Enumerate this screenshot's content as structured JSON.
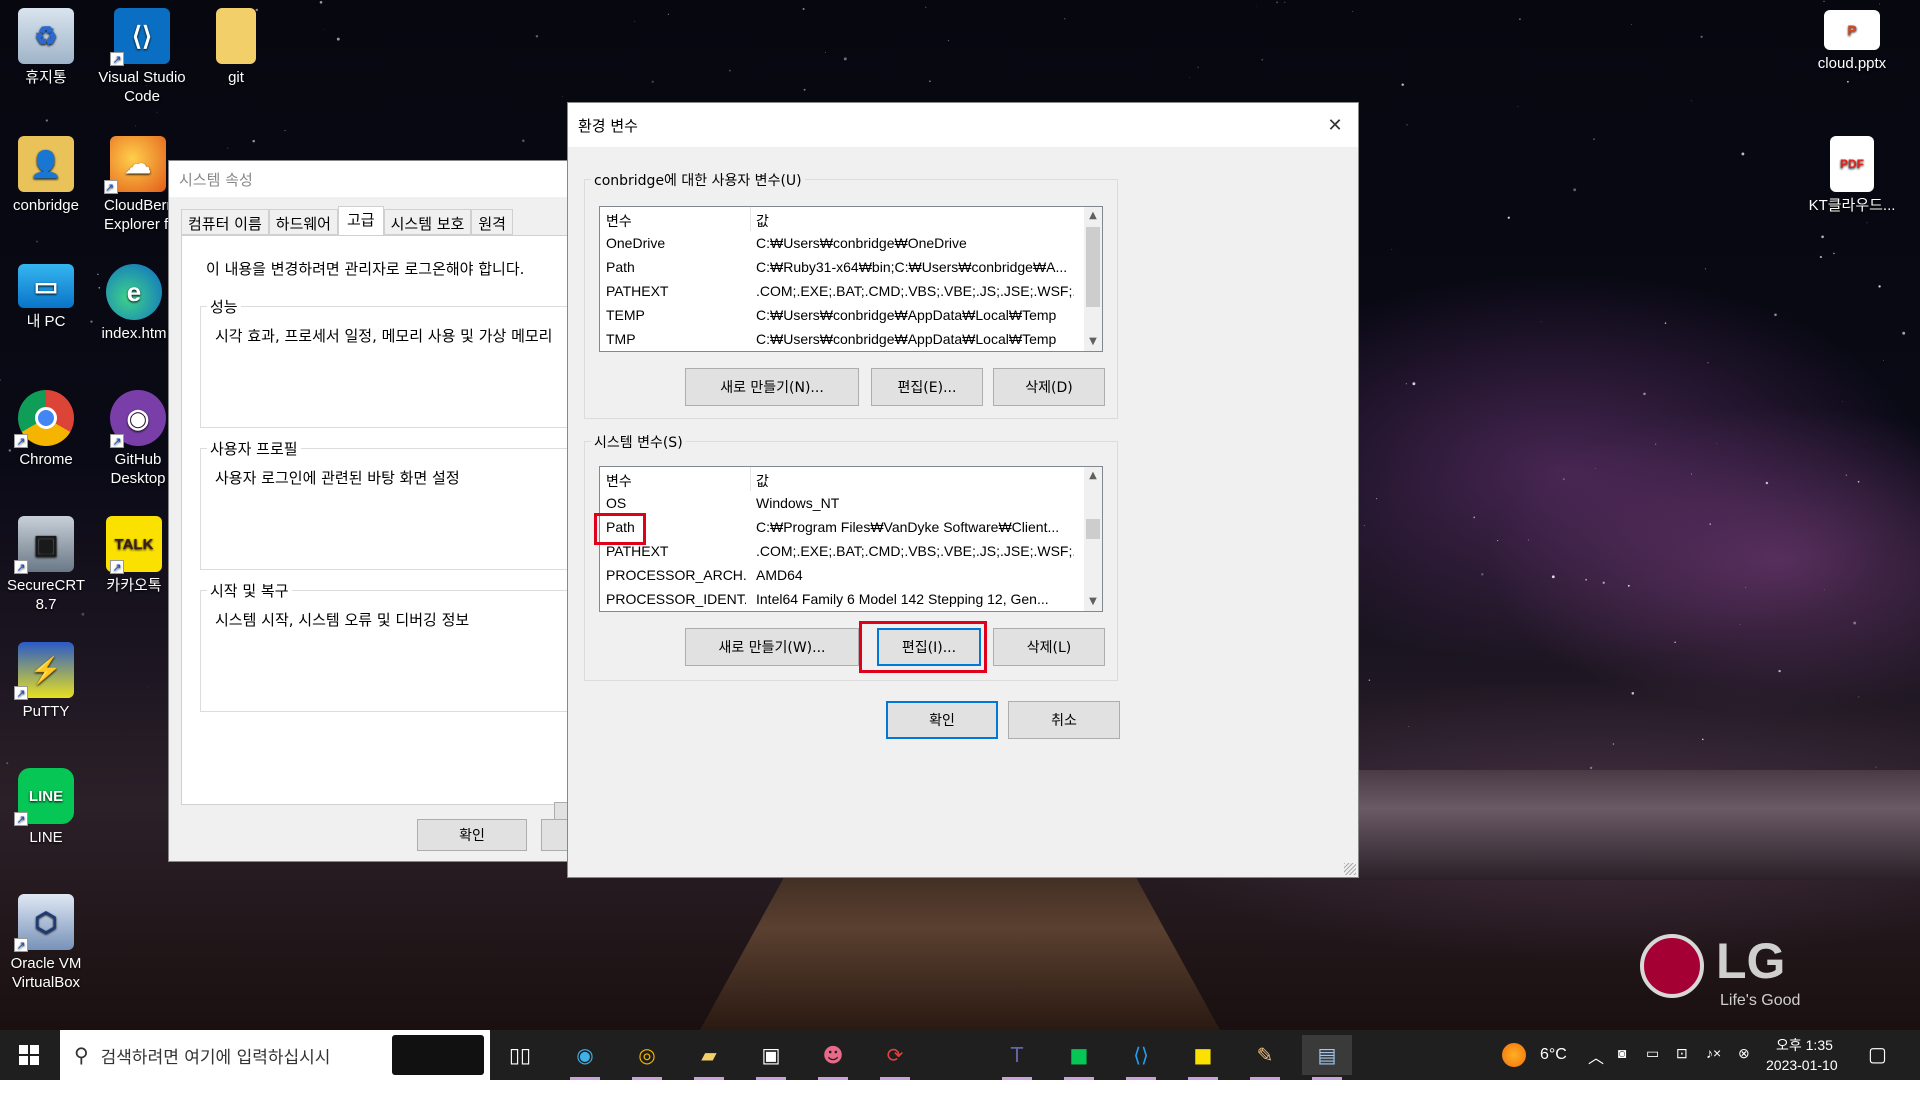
{
  "desktop": {
    "icons": [
      {
        "label": "휴지통",
        "icon": "recycle-bin-icon"
      },
      {
        "label": "Visual Studio Code",
        "icon": "vscode-icon"
      },
      {
        "label": "git",
        "icon": "folder-icon"
      },
      {
        "label": "conbridge",
        "icon": "user-folder-icon"
      },
      {
        "label": "CloudBerry Explorer f",
        "icon": "cloudberry-icon"
      },
      {
        "label": "내 PC",
        "icon": "this-pc-icon"
      },
      {
        "label": "index.htm",
        "icon": "edge-icon"
      },
      {
        "label": "Chrome",
        "icon": "chrome-icon"
      },
      {
        "label": "GitHub Desktop",
        "icon": "github-icon"
      },
      {
        "label": "SecureCRT 8.7",
        "icon": "securecrt-icon"
      },
      {
        "label": "카카오톡",
        "icon": "kakaotalk-icon"
      },
      {
        "label": "PuTTY",
        "icon": "putty-icon"
      },
      {
        "label": "LINE",
        "icon": "line-icon"
      },
      {
        "label": "Oracle VM VirtualBox",
        "icon": "virtualbox-icon"
      },
      {
        "label": "cloud.pptx",
        "icon": "pptx-icon"
      },
      {
        "label": "KT클라우드...",
        "icon": "pdf-icon"
      }
    ],
    "brand": {
      "logo": "LG",
      "tagline": "Life's Good"
    }
  },
  "system_properties": {
    "title": "시스템 속성",
    "tabs": [
      "컴퓨터 이름",
      "하드웨어",
      "고급",
      "시스템 보호",
      "원격"
    ],
    "active_tab": "고급",
    "admin_note": "이 내용을 변경하려면 관리자로 로그온해야 합니다.",
    "sections": [
      {
        "label": "성능",
        "text": "시각 효과, 프로세서 일정, 메모리 사용 및 가상 메모리"
      },
      {
        "label": "사용자 프로필",
        "text": "사용자 로그인에 관련된 바탕 화면 설정"
      },
      {
        "label": "시작 및 복구",
        "text": "시스템 시작, 시스템 오류 및 디버깅 정보"
      }
    ],
    "ok_label": "확인"
  },
  "env_dialog": {
    "title": "환경 변수",
    "close_glyph": "✕",
    "user_group_label": "conbridge에 대한 사용자 변수(U)",
    "columns": [
      "변수",
      "값"
    ],
    "user_vars": [
      {
        "name": "OneDrive",
        "value": "C:₩Users₩conbridge₩OneDrive"
      },
      {
        "name": "Path",
        "value": "C:₩Ruby31-x64₩bin;C:₩Users₩conbridge₩A..."
      },
      {
        "name": "PATHEXT",
        "value": ".COM;.EXE;.BAT;.CMD;.VBS;.VBE;.JS;.JSE;.WSF;..."
      },
      {
        "name": "TEMP",
        "value": "C:₩Users₩conbridge₩AppData₩Local₩Temp"
      },
      {
        "name": "TMP",
        "value": "C:₩Users₩conbridge₩AppData₩Local₩Temp"
      }
    ],
    "user_buttons": {
      "new": "새로 만들기(N)...",
      "edit": "편집(E)...",
      "delete": "삭제(D)"
    },
    "system_group_label": "시스템 변수(S)",
    "system_vars": [
      {
        "name": "OS",
        "value": "Windows_NT"
      },
      {
        "name": "Path",
        "value": "C:₩Program Files₩VanDyke Software₩Client..."
      },
      {
        "name": "PATHEXT",
        "value": ".COM;.EXE;.BAT;.CMD;.VBS;.VBE;.JS;.JSE;.WSF;..."
      },
      {
        "name": "PROCESSOR_ARCH...",
        "value": "AMD64"
      },
      {
        "name": "PROCESSOR_IDENT...",
        "value": "Intel64 Family 6 Model 142 Stepping 12, Gen..."
      }
    ],
    "system_buttons": {
      "new": "새로 만들기(W)...",
      "edit": "편집(I)...",
      "delete": "삭제(L)"
    },
    "ok_label": "확인",
    "cancel_label": "취소",
    "highlight_color": "#e0001b"
  },
  "taskbar": {
    "search_placeholder": "검색하려면 여기에 입력하십시시",
    "weather": "6°C",
    "time": "오후 1:35",
    "date": "2023-01-10",
    "pinned": [
      "task-view-icon",
      "edge-icon",
      "chrome-icon",
      "file-explorer-icon",
      "terminal-icon",
      "app-icon",
      "sync-icon",
      "teams-icon",
      "line-icon",
      "vscode-icon",
      "kakaotalk-icon",
      "paint-icon",
      "remote-desktop-icon"
    ]
  }
}
